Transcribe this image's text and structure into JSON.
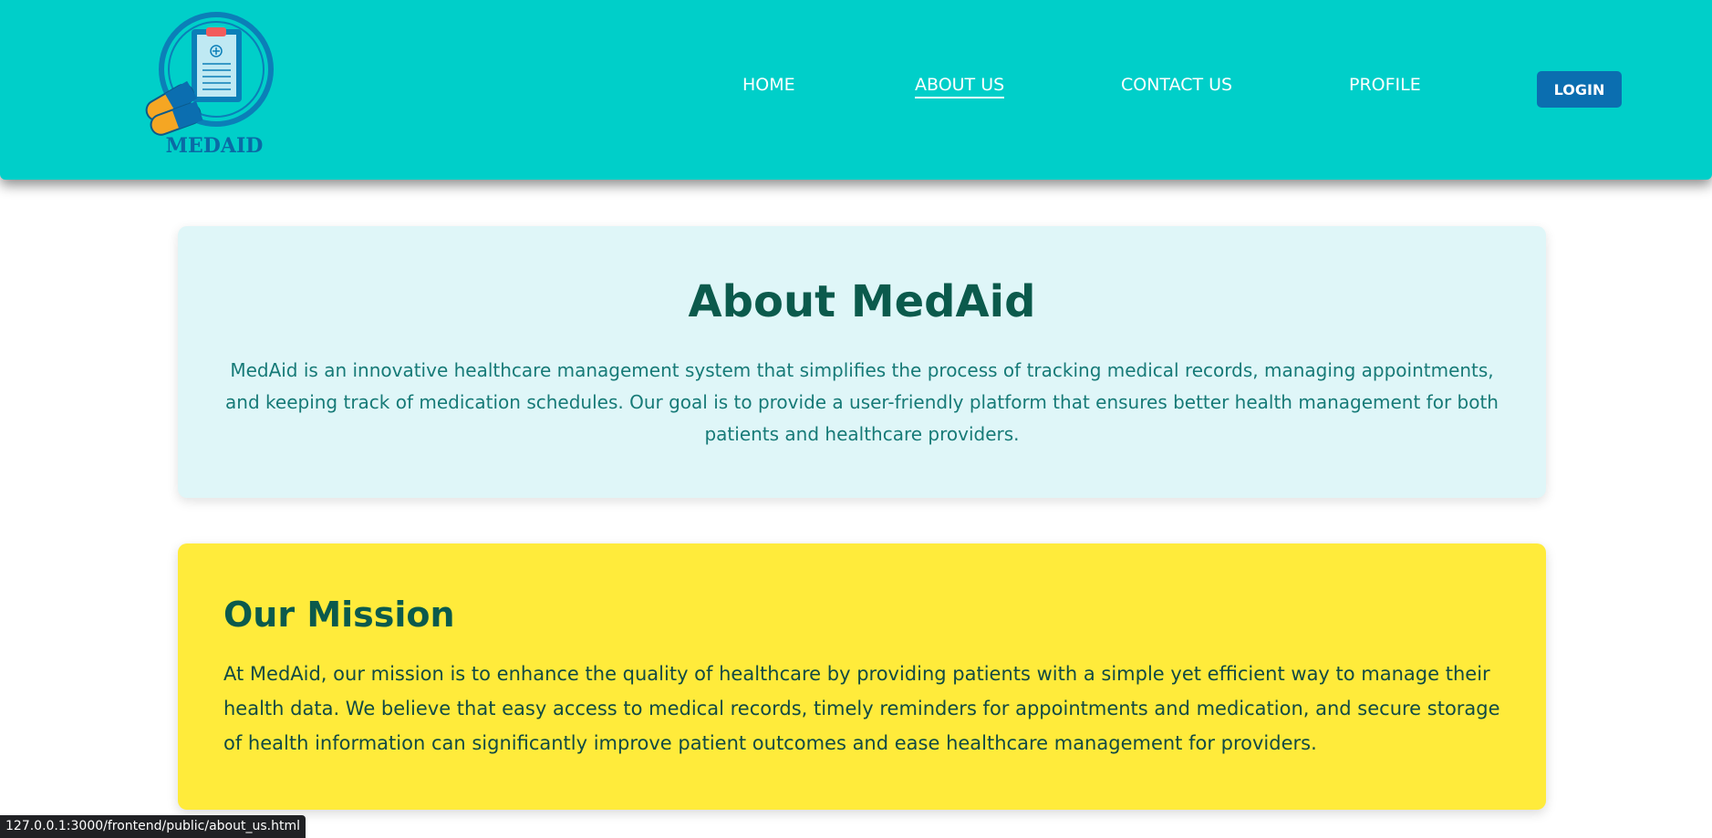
{
  "brand": {
    "logo_text": "MEDAID"
  },
  "nav": {
    "items": [
      {
        "label": "HOME"
      },
      {
        "label": "ABOUT US"
      },
      {
        "label": "CONTACT US"
      },
      {
        "label": "PROFILE"
      }
    ],
    "active_item": "ABOUT US",
    "login_label": "LOGIN"
  },
  "about": {
    "title": "About MedAid",
    "text": "MedAid is an innovative healthcare management system that simplifies the process of tracking medical records, managing appointments, and keeping track of medication schedules. Our goal is to provide a user-friendly platform that ensures better health management for both patients and healthcare providers."
  },
  "mission": {
    "title": "Our Mission",
    "text": "At MedAid, our mission is to enhance the quality of healthcare by providing patients with a simple yet efficient way to manage their health data. We believe that easy access to medical records, timely reminders for appointments and medication, and secure storage of health information can significantly improve patient outcomes and ease healthcare management for providers."
  },
  "status_bar": {
    "url": "127.0.0.1:3000/frontend/public/about_us.html"
  },
  "colors": {
    "header_bg": "#00cfc9",
    "login_bg": "#0b6eb0",
    "about_bg": "#dff6f8",
    "mission_bg": "#ffeb3b",
    "heading": "#0b5a4c"
  },
  "icons": {
    "logo": "clipboard-pill-logo-icon"
  }
}
